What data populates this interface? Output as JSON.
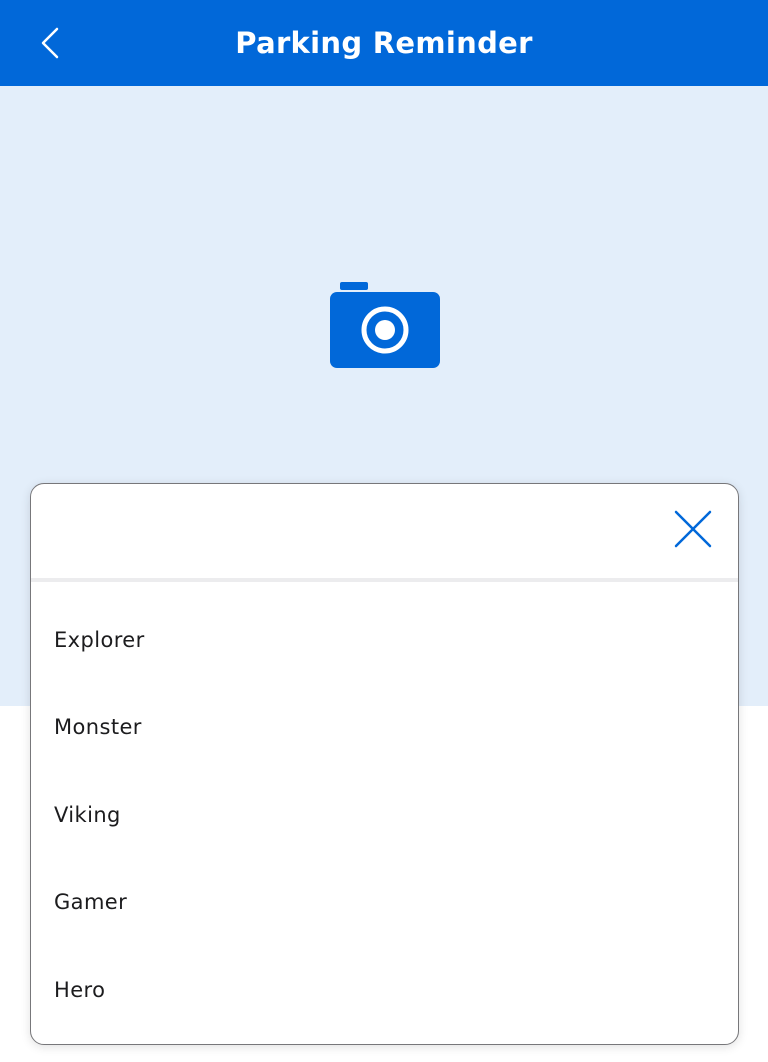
{
  "header": {
    "title": "Parking Reminder",
    "back_icon": "chevron-left-icon",
    "background_color": "#0168d9"
  },
  "photo_area": {
    "icon": "camera-icon",
    "background_color": "#e3eefa",
    "icon_color": "#0168d9"
  },
  "sheet": {
    "close_icon": "close-icon",
    "options": [
      {
        "label": "Explorer"
      },
      {
        "label": "Monster"
      },
      {
        "label": "Viking"
      },
      {
        "label": "Gamer"
      },
      {
        "label": "Hero"
      }
    ]
  }
}
